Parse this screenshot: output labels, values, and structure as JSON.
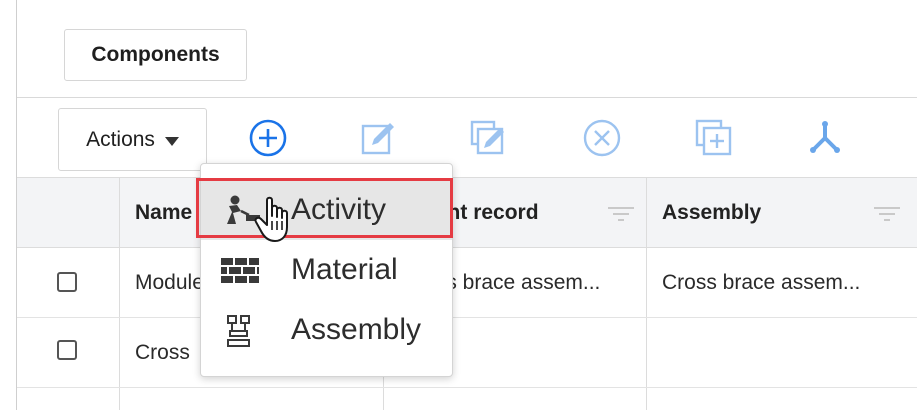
{
  "header": {
    "components_label": "Components"
  },
  "toolbar": {
    "actions_label": "Actions",
    "icons": [
      "add-circle-icon",
      "edit-icon",
      "bulk-edit-icon",
      "delete-circle-icon",
      "duplicate-icon",
      "split-icon"
    ],
    "accent_color": "#1a73e8",
    "disabled_color": "#9cc3f0"
  },
  "table": {
    "columns": [
      {
        "label": "Name"
      },
      {
        "label": "Parent record"
      },
      {
        "label": "Assembly"
      }
    ],
    "rows": [
      {
        "name": "Module",
        "parent": "Cross brace assem...",
        "assembly": "Cross brace assem..."
      },
      {
        "name": "Cross",
        "parent": "",
        "assembly": ""
      }
    ]
  },
  "dropdown": {
    "items": [
      {
        "label": "Activity",
        "icon": "activity-worker-icon",
        "hovered": true
      },
      {
        "label": "Material",
        "icon": "material-bricks-icon",
        "hovered": false
      },
      {
        "label": "Assembly",
        "icon": "assembly-icon",
        "hovered": false
      }
    ],
    "highlight_color": "#e53b43"
  }
}
